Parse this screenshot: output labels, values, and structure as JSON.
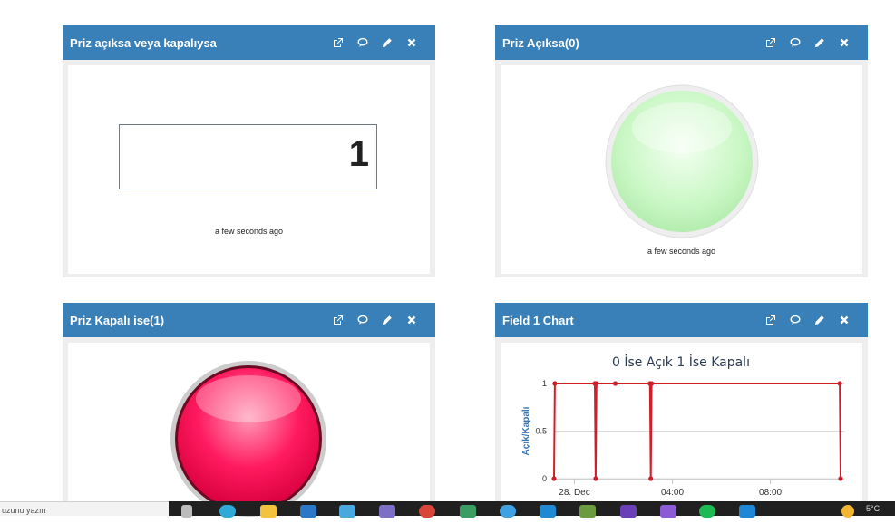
{
  "widgets": [
    {
      "title": "Priz açıksa veya kapalıysa",
      "value": "1",
      "timestamp": "a few seconds ago"
    },
    {
      "title": "Priz Açıksa(0)",
      "lamp_color": "#c9f7c4",
      "timestamp": "a few seconds ago"
    },
    {
      "title": "Priz Kapalı ise(1)",
      "lamp_color": "#ff1a5e"
    },
    {
      "title": "Field 1 Chart"
    }
  ],
  "tool_icons": [
    "external-link-icon",
    "comment-icon",
    "pencil-icon",
    "close-icon"
  ],
  "colors": {
    "header": "#3a80b8",
    "series": "#d11f2a"
  },
  "chart_data": {
    "type": "line",
    "title": "0 İse Açık 1 İse Kapalı",
    "ylabel": "Açık/Kapalı",
    "xlabel": "",
    "ylim": [
      0,
      1
    ],
    "y_ticks": [
      "0",
      "0.5",
      "1"
    ],
    "x_ticks": [
      "28. Dec",
      "04:00",
      "08:00"
    ],
    "grid": true,
    "series": [
      {
        "values": [
          {
            "x": "27. Dec 23:10",
            "y": 0
          },
          {
            "x": "27. Dec 23:12",
            "y": 1
          },
          {
            "x": "28. Dec 00:50",
            "y": 1
          },
          {
            "x": "28. Dec 00:52",
            "y": 0
          },
          {
            "x": "28. Dec 00:54",
            "y": 1
          },
          {
            "x": "28. Dec 01:40",
            "y": 1
          },
          {
            "x": "28. Dec 03:05",
            "y": 1
          },
          {
            "x": "28. Dec 03:07",
            "y": 0
          },
          {
            "x": "28. Dec 03:09",
            "y": 1
          },
          {
            "x": "28. Dec 10:50",
            "y": 1
          },
          {
            "x": "28. Dec 10:52",
            "y": 0
          }
        ]
      }
    ]
  },
  "taskbar": {
    "search_text": "uzunu yazın",
    "weather": "5°C"
  }
}
